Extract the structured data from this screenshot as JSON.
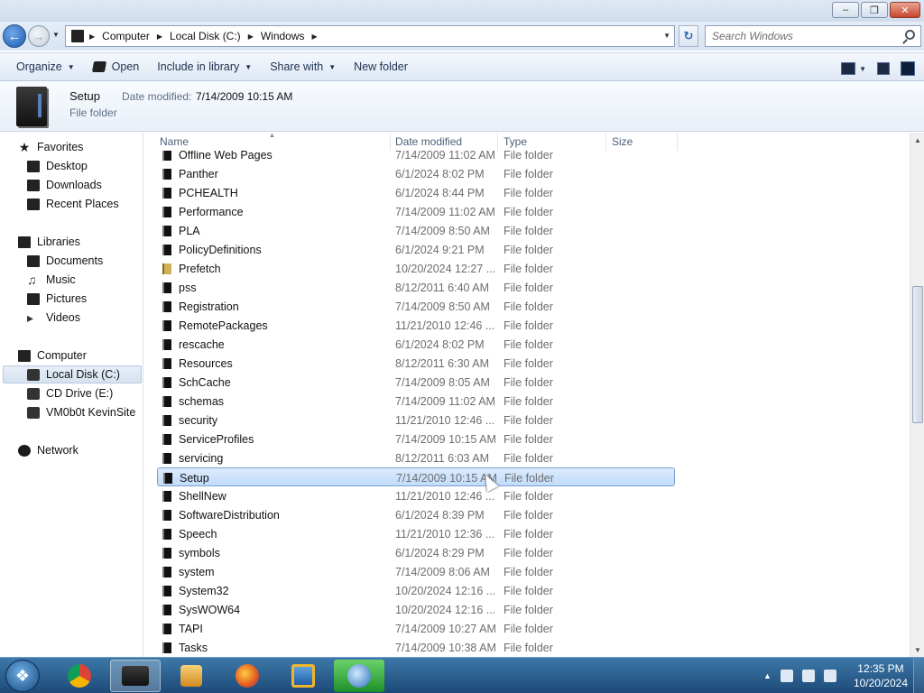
{
  "address": {
    "crumbs": [
      "Computer",
      "Local Disk (C:)",
      "Windows"
    ]
  },
  "search": {
    "placeholder": "Search Windows"
  },
  "toolbar": {
    "organize": "Organize",
    "open": "Open",
    "include": "Include in library",
    "share": "Share with",
    "new_folder": "New folder"
  },
  "details": {
    "name": "Setup",
    "date_label": "Date modified:",
    "date": "7/14/2009 10:15 AM",
    "type": "File folder"
  },
  "nav": {
    "favorites": "Favorites",
    "desktop": "Desktop",
    "downloads": "Downloads",
    "recent": "Recent Places",
    "libraries": "Libraries",
    "documents": "Documents",
    "music": "Music",
    "pictures": "Pictures",
    "videos": "Videos",
    "computer": "Computer",
    "local_disk": "Local Disk (C:)",
    "cd_drive": "CD Drive (E:)",
    "vm": "VM0b0t KevinSite",
    "network": "Network"
  },
  "columns": {
    "name": "Name",
    "date": "Date modified",
    "type": "Type",
    "size": "Size"
  },
  "files": [
    {
      "name": "Offline Web Pages",
      "date": "7/14/2009 11:02 AM",
      "type": "File folder"
    },
    {
      "name": "Panther",
      "date": "6/1/2024 8:02 PM",
      "type": "File folder"
    },
    {
      "name": "PCHEALTH",
      "date": "6/1/2024 8:44 PM",
      "type": "File folder"
    },
    {
      "name": "Performance",
      "date": "7/14/2009 11:02 AM",
      "type": "File folder"
    },
    {
      "name": "PLA",
      "date": "7/14/2009 8:50 AM",
      "type": "File folder"
    },
    {
      "name": "PolicyDefinitions",
      "date": "6/1/2024 9:21 PM",
      "type": "File folder"
    },
    {
      "name": "Prefetch",
      "date": "10/20/2024 12:27 ...",
      "type": "File folder"
    },
    {
      "name": "pss",
      "date": "8/12/2011 6:40 AM",
      "type": "File folder"
    },
    {
      "name": "Registration",
      "date": "7/14/2009 8:50 AM",
      "type": "File folder"
    },
    {
      "name": "RemotePackages",
      "date": "11/21/2010 12:46 ...",
      "type": "File folder"
    },
    {
      "name": "rescache",
      "date": "6/1/2024 8:02 PM",
      "type": "File folder"
    },
    {
      "name": "Resources",
      "date": "8/12/2011 6:30 AM",
      "type": "File folder"
    },
    {
      "name": "SchCache",
      "date": "7/14/2009 8:05 AM",
      "type": "File folder"
    },
    {
      "name": "schemas",
      "date": "7/14/2009 11:02 AM",
      "type": "File folder"
    },
    {
      "name": "security",
      "date": "11/21/2010 12:46 ...",
      "type": "File folder"
    },
    {
      "name": "ServiceProfiles",
      "date": "7/14/2009 10:15 AM",
      "type": "File folder"
    },
    {
      "name": "servicing",
      "date": "8/12/2011 6:03 AM",
      "type": "File folder"
    },
    {
      "name": "Setup",
      "date": "7/14/2009 10:15 AM",
      "type": "File folder"
    },
    {
      "name": "ShellNew",
      "date": "11/21/2010 12:46 ...",
      "type": "File folder"
    },
    {
      "name": "SoftwareDistribution",
      "date": "6/1/2024 8:39 PM",
      "type": "File folder"
    },
    {
      "name": "Speech",
      "date": "11/21/2010 12:36 ...",
      "type": "File folder"
    },
    {
      "name": "symbols",
      "date": "6/1/2024 8:29 PM",
      "type": "File folder"
    },
    {
      "name": "system",
      "date": "7/14/2009 8:06 AM",
      "type": "File folder"
    },
    {
      "name": "System32",
      "date": "10/20/2024 12:16 ...",
      "type": "File folder"
    },
    {
      "name": "SysWOW64",
      "date": "10/20/2024 12:16 ...",
      "type": "File folder"
    },
    {
      "name": "TAPI",
      "date": "7/14/2009 10:27 AM",
      "type": "File folder"
    },
    {
      "name": "Tasks",
      "date": "7/14/2009 10:38 AM",
      "type": "File folder"
    }
  ],
  "selected_file": "Setup",
  "clock": {
    "time": "12:35 PM",
    "date": "10/20/2024"
  },
  "colors": {
    "selection": "#c1dcfc",
    "taskbar": "#1c4a78"
  }
}
